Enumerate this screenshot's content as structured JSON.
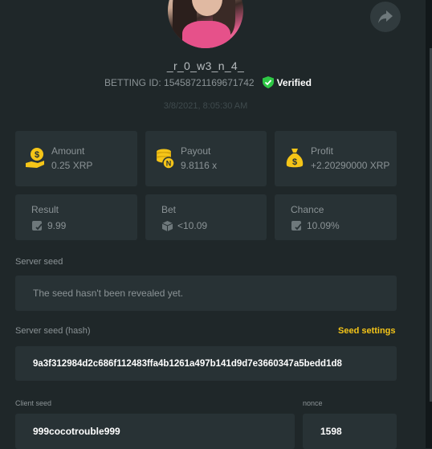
{
  "profile": {
    "username": "_r_0_w3_n_4_",
    "betting_id_label": "BETTING ID:",
    "betting_id": "15458721169671742",
    "verified_label": "Verified",
    "datetime": "3/8/2021, 8:05:30 AM"
  },
  "stats": {
    "amount": {
      "label": "Amount",
      "value": "0.25 XRP"
    },
    "payout": {
      "label": "Payout",
      "value": "9.8116 x"
    },
    "profit": {
      "label": "Profit",
      "value": "+2.20290000 XRP"
    },
    "result": {
      "label": "Result",
      "value": "9.99"
    },
    "bet": {
      "label": "Bet",
      "value": "<10.09"
    },
    "chance": {
      "label": "Chance",
      "value": "10.09%"
    }
  },
  "server_seed": {
    "label": "Server seed",
    "value": "The seed hasn't been revealed yet."
  },
  "server_seed_hash": {
    "label": "Server seed (hash)",
    "settings_link": "Seed settings",
    "value": "9a3f312984d2c686f112483ffa4b1261a497b141d9d7e3660347a5bedd1d8"
  },
  "client_seed": {
    "label": "Client seed",
    "value": "999cocotrouble999"
  },
  "nonce": {
    "label": "nonce",
    "value": "1598"
  },
  "colors": {
    "background": "#1f2729",
    "card": "#283235",
    "accent_yellow": "#f5c518",
    "verified_green": "#2ec845"
  },
  "icons": [
    "share-icon",
    "verified-shield-icon",
    "coin-hand-icon",
    "coin-stack-icon",
    "money-bag-icon",
    "dice-icon"
  ]
}
